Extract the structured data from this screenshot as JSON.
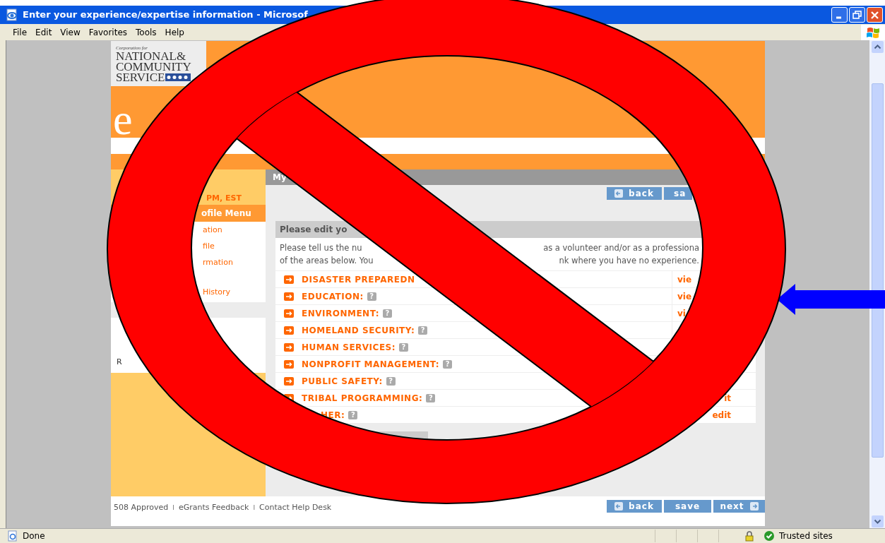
{
  "window": {
    "title": "Enter your experience/expertise information - Microsof"
  },
  "menu_bar": [
    "File",
    "Edit",
    "View",
    "Favorites",
    "Tools",
    "Help"
  ],
  "logo": {
    "tagline": "Corporation for",
    "lines": [
      "NATIONAL&",
      "COMMUNITY",
      "SERVICE"
    ]
  },
  "banner": {
    "text": "e"
  },
  "sidebar": {
    "time": "PM, EST",
    "menu_title": "ofile Menu",
    "items": [
      "ation",
      "file",
      "rmation",
      "History"
    ],
    "box_text": "R"
  },
  "page_bar": {
    "title": "My"
  },
  "top_buttons": [
    {
      "label": "back",
      "kind": "back"
    },
    {
      "label": "sa",
      "kind": "plain"
    }
  ],
  "edit_panel": {
    "title": "Please edit yo",
    "lines": [
      {
        "left": "Please tell us the nu",
        "right": "as a volunteer and/or as a professiona"
      },
      {
        "left": "of the areas below. You",
        "right": "nk where you have no experience."
      }
    ],
    "rows": [
      {
        "kind": "full",
        "icon": true,
        "label": "DISASTER PREPAREDN",
        "view": "vie"
      },
      {
        "kind": "full",
        "icon": true,
        "label": "EDUCATION:",
        "help": "?",
        "view": "vie"
      },
      {
        "kind": "full",
        "icon": true,
        "label": "ENVIRONMENT:",
        "help": "?",
        "view": "vi"
      },
      {
        "kind": "full",
        "icon": true,
        "label": "HOMELAND SECURITY:",
        "help": "?"
      },
      {
        "kind": "full",
        "icon": true,
        "label": "HUMAN SERVICES:",
        "help": "?"
      },
      {
        "kind": "full",
        "icon": true,
        "label": "NONPROFIT MANAGEMENT:",
        "help": "?"
      },
      {
        "kind": "full",
        "icon": true,
        "label": "PUBLIC SAFETY:",
        "help": "?"
      },
      {
        "kind": "full",
        "icon": true,
        "label": "TRIBAL PROGRAMMING:",
        "help": "?",
        "edit": "it"
      },
      {
        "kind": "cut",
        "icon": false,
        "label": "HER:",
        "help": "?",
        "edit": "edit"
      }
    ]
  },
  "footer": {
    "links": [
      "508 Approved",
      "eGrants Feedback",
      "Contact Help Desk"
    ],
    "separators": [
      "I",
      "I"
    ],
    "buttons": [
      {
        "label": "back",
        "kind": "back"
      },
      {
        "label": "save",
        "kind": "plain"
      },
      {
        "label": "next",
        "kind": "next"
      }
    ]
  },
  "status_bar": {
    "text": "Done",
    "zone": "Trusted sites"
  }
}
